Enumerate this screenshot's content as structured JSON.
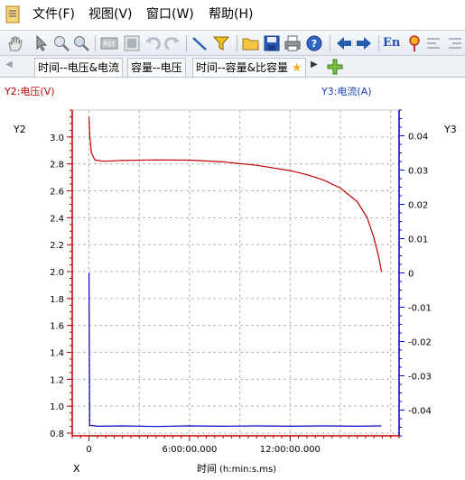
{
  "menu": {
    "file": "文件(F)",
    "view": "视图(V)",
    "window": "窗口(W)",
    "help": "帮助(H)"
  },
  "toolbar": {
    "icons": [
      "hand-icon",
      "pointer-icon",
      "zoom-in-icon",
      "zoom-icon",
      "reset-icon",
      "report-icon",
      "undo-icon",
      "redo-icon",
      "line-tool-icon",
      "filter-icon",
      "open-folder-icon",
      "save-icon",
      "print-icon",
      "help-icon",
      "back-arrow-icon",
      "forward-arrow-icon",
      "english-icon",
      "settings-icon",
      "align-left-icon",
      "align-right-icon"
    ],
    "lang_label": "En"
  },
  "tabs": [
    {
      "label": "时间--电压&电流"
    },
    {
      "label": "容量--电压"
    },
    {
      "label": "时间--容量&比容量"
    }
  ],
  "chart_data": {
    "type": "line",
    "left_axis_header": "Y2:电压(V)",
    "right_axis_header": "Y3:电流(A)",
    "y2_label": "Y2",
    "y3_label": "Y3",
    "x_label": "X",
    "x_title": "时间",
    "x_unit": "(h:min:s.ms)",
    "x_ticks": [
      "0",
      "6:00:00.000",
      "12:00:00.000"
    ],
    "x_range_hours": [
      -1,
      18.5
    ],
    "y2_range": [
      0.78,
      3.2
    ],
    "y2_ticks": [
      "0.8",
      "1.0",
      "1.2",
      "1.4",
      "1.6",
      "1.8",
      "2.0",
      "2.2",
      "2.4",
      "2.6",
      "2.8",
      "3.0"
    ],
    "y3_range": [
      -0.0475,
      0.0475
    ],
    "y3_ticks": [
      "-0.04",
      "-0.03",
      "-0.02",
      "-0.01",
      "0",
      "0.01",
      "0.02",
      "0.03",
      "0.04"
    ],
    "grid": true,
    "series": [
      {
        "axis": "y2",
        "color": "#c00000",
        "points": [
          [
            0,
            3.15
          ],
          [
            0.05,
            3.0
          ],
          [
            0.15,
            2.88
          ],
          [
            0.35,
            2.83
          ],
          [
            0.8,
            2.82
          ],
          [
            2,
            2.825
          ],
          [
            4,
            2.83
          ],
          [
            6,
            2.828
          ],
          [
            8,
            2.815
          ],
          [
            10,
            2.79
          ],
          [
            12,
            2.75
          ],
          [
            13,
            2.72
          ],
          [
            14,
            2.68
          ],
          [
            15,
            2.62
          ],
          [
            16,
            2.52
          ],
          [
            16.6,
            2.4
          ],
          [
            17,
            2.25
          ],
          [
            17.3,
            2.1
          ],
          [
            17.45,
            2.0
          ]
        ]
      },
      {
        "axis": "y3",
        "color": "#0000c8",
        "points": [
          [
            0,
            0
          ],
          [
            0.04,
            -0.0445
          ],
          [
            0.2,
            -0.0445
          ],
          [
            0.5,
            -0.0447
          ],
          [
            2,
            -0.0446
          ],
          [
            4,
            -0.0448
          ],
          [
            6,
            -0.0446
          ],
          [
            8,
            -0.0447
          ],
          [
            10,
            -0.0446
          ],
          [
            12,
            -0.0447
          ],
          [
            14,
            -0.0446
          ],
          [
            16,
            -0.0447
          ],
          [
            17.45,
            -0.0446
          ]
        ]
      }
    ]
  }
}
